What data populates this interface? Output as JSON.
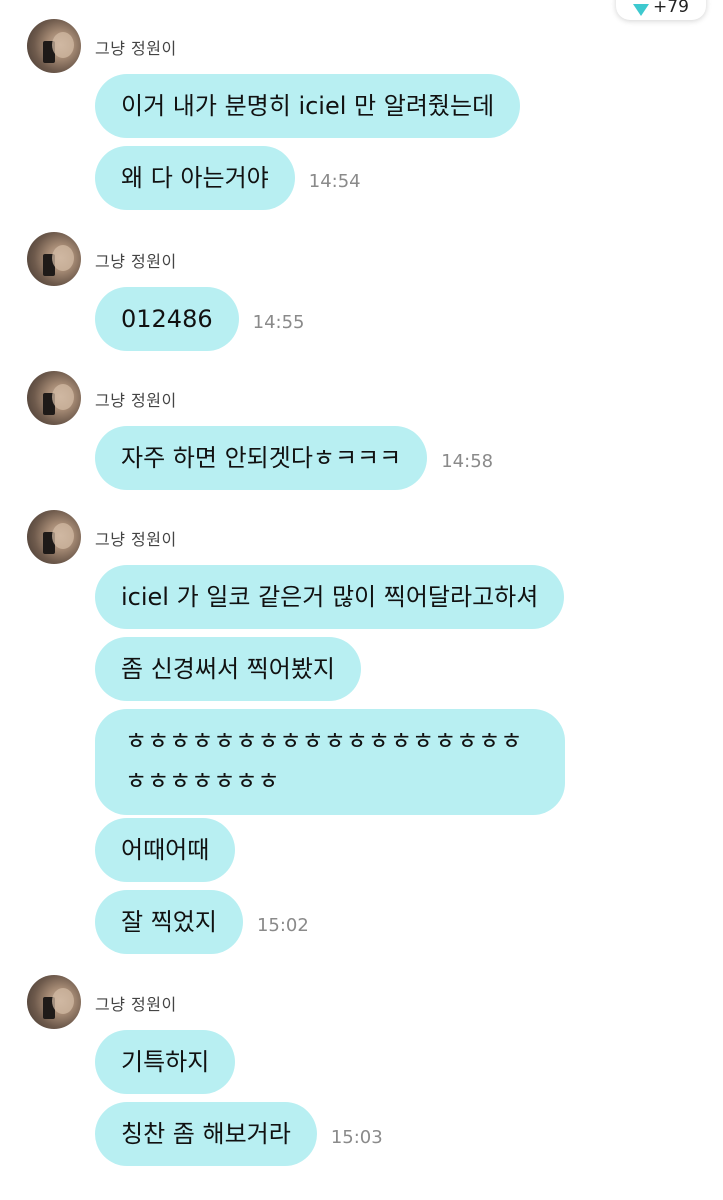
{
  "badge": {
    "count": "+79",
    "color": "#3ec9cf"
  },
  "bubble_color": "#b8eff2",
  "groups": [
    {
      "sender": "그냥 정원이",
      "messages": [
        {
          "text": "이거 내가 분명히 iciel 만 알려줬는데",
          "time": ""
        },
        {
          "text": "왜 다 아는거야",
          "time": "14:54"
        }
      ]
    },
    {
      "sender": "그냥 정원이",
      "messages": [
        {
          "text": "012486",
          "time": "14:55"
        }
      ]
    },
    {
      "sender": "그냥 정원이",
      "messages": [
        {
          "text": "자주 하면 안되겟다ㅎㅋㅋㅋ",
          "time": "14:58"
        }
      ]
    },
    {
      "sender": "그냥 정원이",
      "messages": [
        {
          "text": "iciel 가 일코 같은거 많이 찍어달라고하셔",
          "time": ""
        },
        {
          "text": "좀 신경써서 찍어봤지",
          "time": ""
        },
        {
          "text": "ㅎㅎㅎㅎㅎㅎㅎㅎㅎㅎㅎㅎㅎㅎㅎㅎㅎㅎㅎㅎㅎㅎㅎㅎㅎ",
          "time": ""
        },
        {
          "text": "어때어때",
          "time": ""
        },
        {
          "text": "잘 찍었지",
          "time": "15:02"
        }
      ]
    },
    {
      "sender": "그냥 정원이",
      "messages": [
        {
          "text": "기특하지",
          "time": ""
        },
        {
          "text": "칭찬 좀 해보거라",
          "time": "15:03"
        }
      ]
    }
  ]
}
